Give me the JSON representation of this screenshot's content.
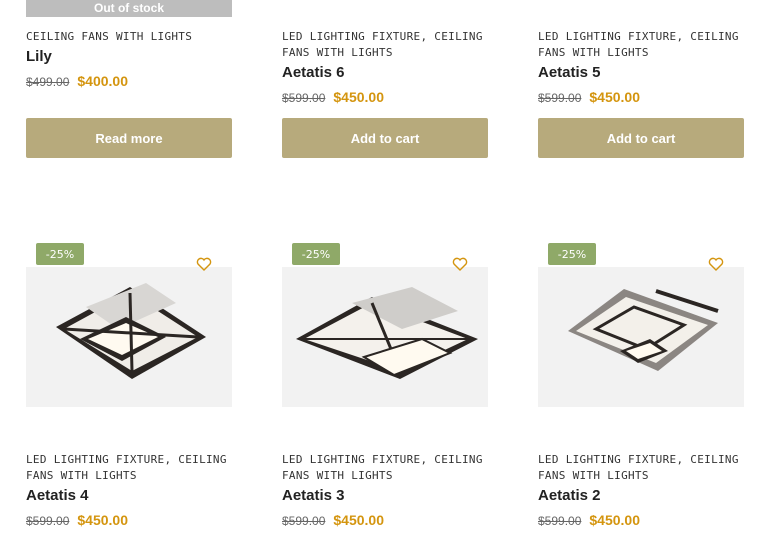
{
  "colors": {
    "accent_price": "#d4950f",
    "button_bg": "#b7aa7c",
    "badge_bg": "#8fa968"
  },
  "row1": [
    {
      "badge_overlay": "Out of stock",
      "categories": "CEILING FANS WITH LIGHTS",
      "title": "Lily",
      "old_price": "$499.00",
      "new_price": "$400.00",
      "button": "Read more"
    },
    {
      "categories": "LED LIGHTING FIXTURE, CEILING FANS WITH LIGHTS",
      "title": "Aetatis 6",
      "old_price": "$599.00",
      "new_price": "$450.00",
      "button": "Add to cart"
    },
    {
      "categories": "LED LIGHTING FIXTURE, CEILING FANS WITH LIGHTS",
      "title": "Aetatis 5",
      "old_price": "$599.00",
      "new_price": "$450.00",
      "button": "Add to cart"
    }
  ],
  "row2": [
    {
      "discount": "-25%",
      "wishlist_icon": "heart-icon",
      "categories": "LED LIGHTING FIXTURE, CEILING FANS WITH LIGHTS",
      "title": "Aetatis 4",
      "old_price": "$599.00",
      "new_price": "$450.00"
    },
    {
      "discount": "-25%",
      "wishlist_icon": "heart-icon",
      "categories": "LED LIGHTING FIXTURE, CEILING FANS WITH LIGHTS",
      "title": "Aetatis 3",
      "old_price": "$599.00",
      "new_price": "$450.00"
    },
    {
      "discount": "-25%",
      "wishlist_icon": "heart-icon",
      "categories": "LED LIGHTING FIXTURE, CEILING FANS WITH LIGHTS",
      "title": "Aetatis 2",
      "old_price": "$599.00",
      "new_price": "$450.00"
    }
  ]
}
